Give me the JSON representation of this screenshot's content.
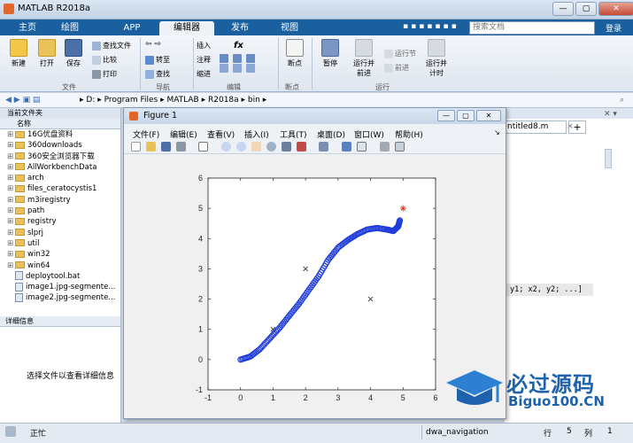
{
  "window": {
    "title": "MATLAB R2018a",
    "min": "—",
    "max": "▢",
    "close": "✕"
  },
  "ribbon_tabs": [
    "主页",
    "绘图",
    "APP",
    "编辑器",
    "发布",
    "视图"
  ],
  "search": {
    "placeholder": "搜索文档"
  },
  "login": "登录",
  "ribbon": {
    "file": {
      "new": "新建",
      "open": "打开",
      "save": "保存",
      "find_files": "查找文件",
      "compare": "比较",
      "print": "打印",
      "group": "文件"
    },
    "nav": {
      "goto": "转至",
      "find": "查找",
      "group": "导航"
    },
    "edit": {
      "insert": "插入",
      "comment": "注释",
      "indent": "缩进",
      "group": "编辑",
      "fx": "fx"
    },
    "breakpoints": {
      "label": "断点",
      "group": "断点"
    },
    "run": {
      "pause": "暂停",
      "run_advance": "运行并前进",
      "run_section": "运行节",
      "advance": "前进",
      "run_time": "运行并计时",
      "group": "运行"
    }
  },
  "address": {
    "parts": [
      "D:",
      "Program Files",
      "MATLAB",
      "R2018a",
      "bin"
    ]
  },
  "current_folder": {
    "title": "当前文件夹",
    "header": "名称",
    "items": [
      {
        "name": "16G优盘资料",
        "type": "folder"
      },
      {
        "name": "360downloads",
        "type": "folder"
      },
      {
        "name": "360安全浏览器下载",
        "type": "folder"
      },
      {
        "name": "AllWorkbenchData",
        "type": "folder"
      },
      {
        "name": "arch",
        "type": "folder"
      },
      {
        "name": "files_ceratocystis1",
        "type": "folder"
      },
      {
        "name": "m3iregistry",
        "type": "folder"
      },
      {
        "name": "path",
        "type": "folder"
      },
      {
        "name": "registry",
        "type": "folder"
      },
      {
        "name": "slprj",
        "type": "folder"
      },
      {
        "name": "util",
        "type": "folder"
      },
      {
        "name": "win32",
        "type": "folder"
      },
      {
        "name": "win64",
        "type": "folder"
      },
      {
        "name": "deploytool.bat",
        "type": "file"
      },
      {
        "name": "image1.jpg-segmente...",
        "type": "file"
      },
      {
        "name": "image2.jpg-segmente...",
        "type": "file"
      }
    ]
  },
  "details": {
    "title": "详细信息",
    "placeholder": "选择文件以查看详细信息"
  },
  "editor": {
    "tab": "ntitled8.m",
    "code": "y1; x2, y2; ...]"
  },
  "status": {
    "ready": "正忙",
    "script": "dwa_navigation",
    "row_label": "行",
    "row": "5",
    "col_label": "列",
    "col": "1"
  },
  "figure": {
    "title": "Figure 1",
    "menu": [
      "文件(F)",
      "编辑(E)",
      "查看(V)",
      "插入(I)",
      "工具(T)",
      "桌面(D)",
      "窗口(W)",
      "帮助(H)"
    ]
  },
  "watermark": {
    "text1": "必过源码",
    "text2": "Biguo100.CN"
  },
  "chart_data": {
    "type": "scatter",
    "xlim": [
      -1,
      6
    ],
    "ylim": [
      -1,
      6
    ],
    "xticks": [
      -1,
      0,
      1,
      2,
      3,
      4,
      5,
      6
    ],
    "yticks": [
      -1,
      0,
      1,
      2,
      3,
      4,
      5,
      6
    ],
    "grid": false,
    "series": [
      {
        "marker": "o",
        "color": "#1f3ddb",
        "x": [
          0,
          0.3,
          0.6,
          0.9,
          1.2,
          1.5,
          1.8,
          2.1,
          2.4,
          2.7,
          3.0,
          3.3,
          3.6,
          3.9,
          4.2,
          4.5,
          4.7,
          4.85,
          4.9
        ],
        "y": [
          0,
          0.1,
          0.35,
          0.7,
          1.05,
          1.45,
          1.85,
          2.3,
          2.75,
          3.3,
          3.7,
          3.95,
          4.15,
          4.3,
          4.35,
          4.3,
          4.25,
          4.4,
          4.6
        ]
      },
      {
        "marker": "x",
        "color": "#333333",
        "x": [
          1,
          2,
          4
        ],
        "y": [
          1,
          3,
          2
        ]
      },
      {
        "marker": "*",
        "color": "#e03b2a",
        "x": [
          5
        ],
        "y": [
          5
        ]
      }
    ]
  }
}
